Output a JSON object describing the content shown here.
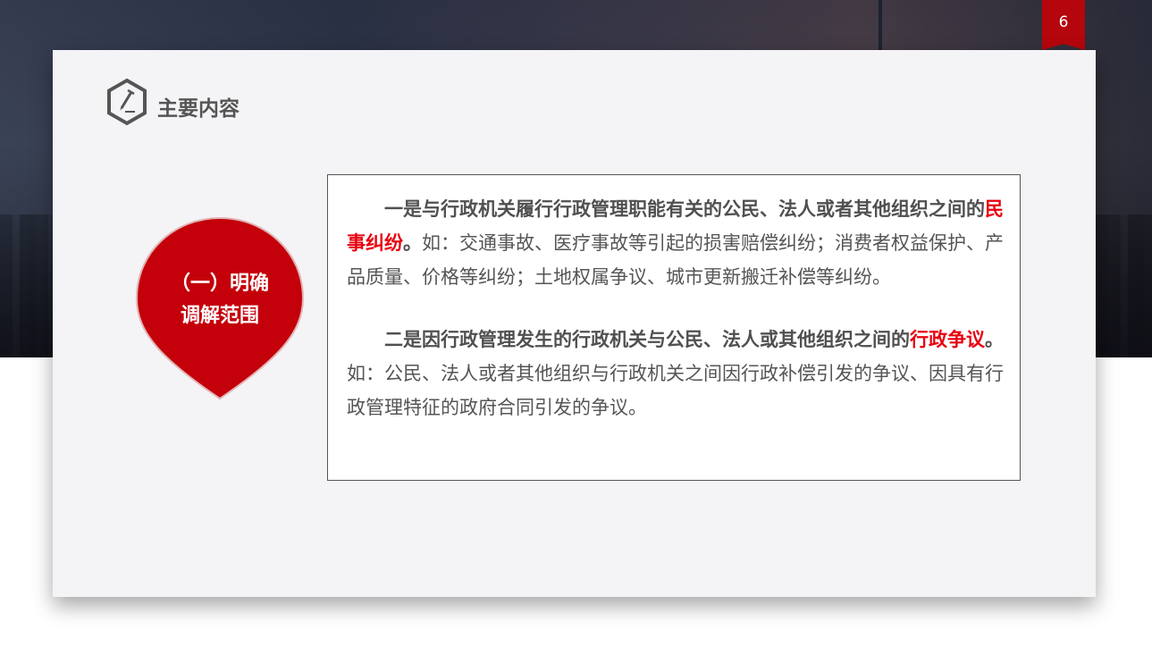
{
  "page_number": "6",
  "header": {
    "title": "主要内容",
    "icon": "pencil-hexagon-icon"
  },
  "pin": {
    "line1": "（一）明确",
    "line2": "调解范围",
    "color": "#c4000a"
  },
  "content": {
    "para1": {
      "lead": "一是与行政机关履行行政管理职能有关的公民、法人或者其他组织之间的",
      "keyword": "民事纠纷",
      "period": "。",
      "rest": "如：交通事故、医疗事故等引起的损害赔偿纠纷；消费者权益保护、产品质量、价格等纠纷；土地权属争议、城市更新搬迁补偿等纠纷。"
    },
    "para2": {
      "lead": "二是因行政管理发生的行政机关与公民、法人或其他组织之间的",
      "keyword": "行政争议",
      "period": "。",
      "rest": "如：公民、法人或者其他组织与行政机关之间因行政补偿引发的争议、因具有行政管理特征的政府合同引发的争议。"
    }
  },
  "colors": {
    "accent_red": "#b4060c",
    "keyword_red": "#e8000f",
    "card_bg": "#f4f3f6"
  }
}
